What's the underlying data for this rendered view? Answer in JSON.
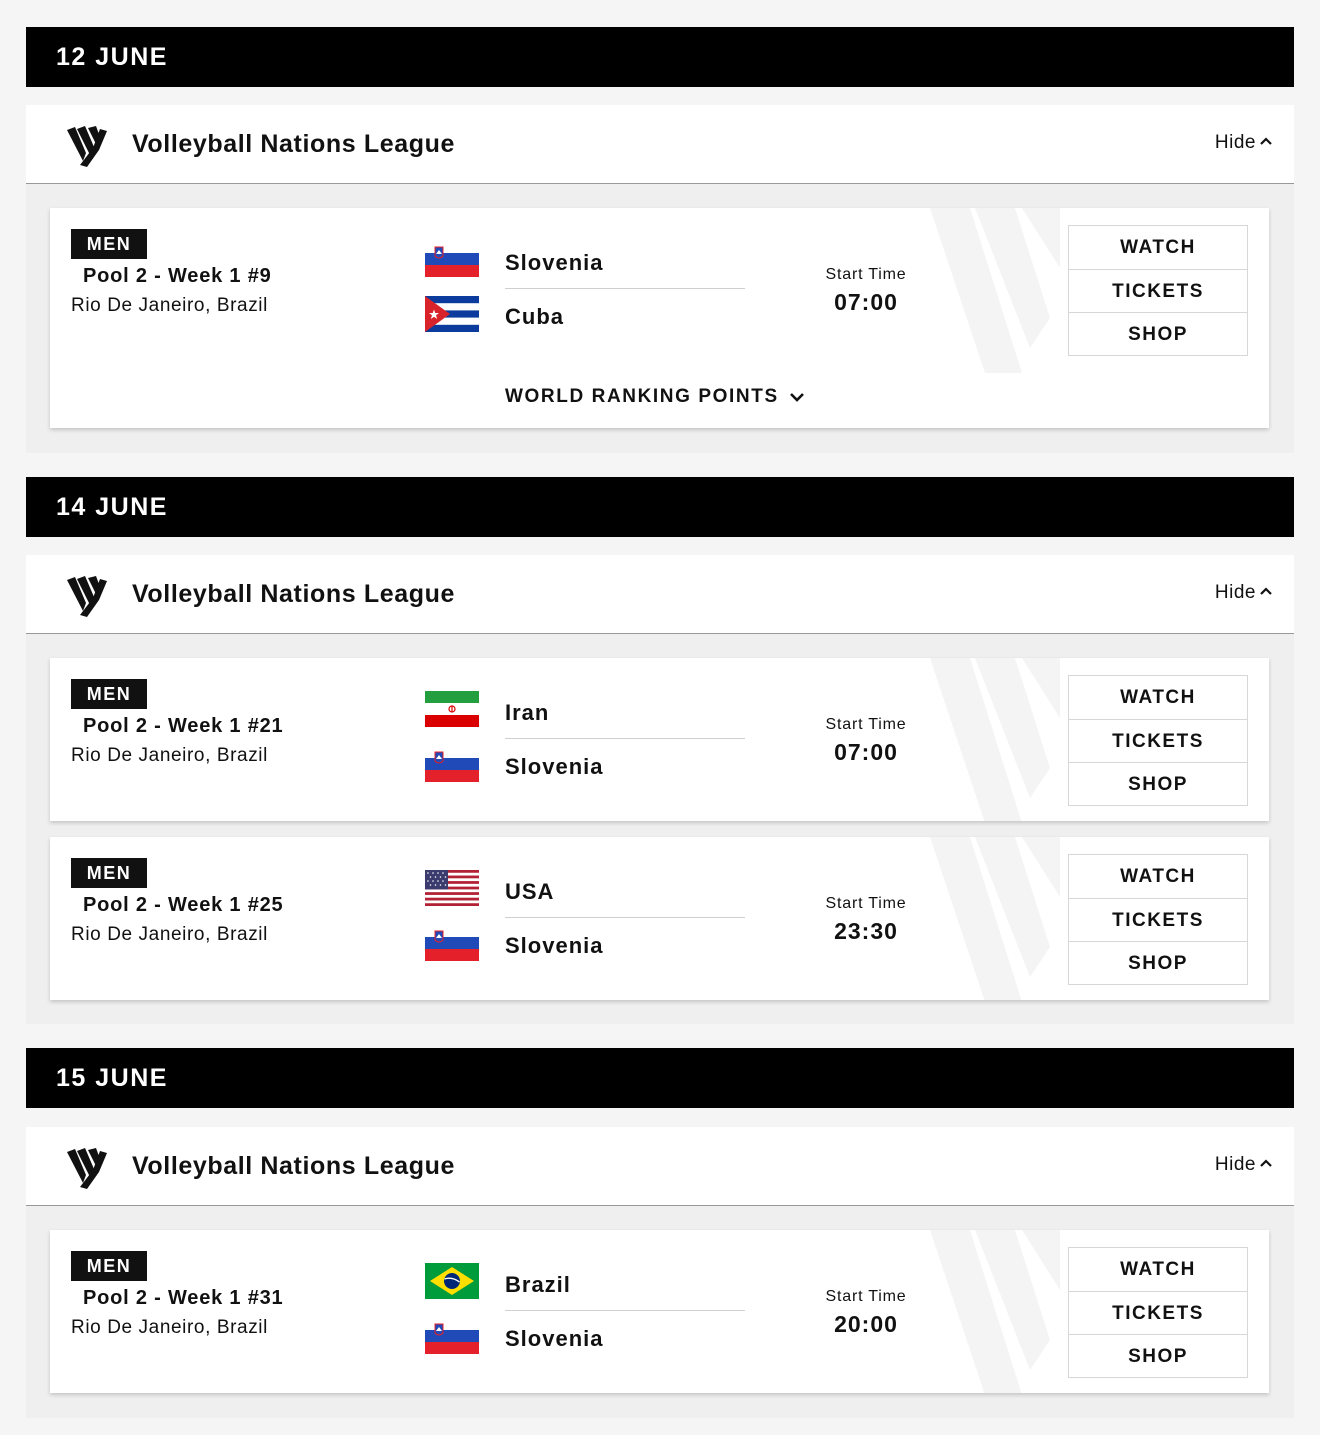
{
  "days": [
    {
      "date": "12 JUNE",
      "competition": "Volleyball Nations League",
      "hide_label": "Hide",
      "matches": [
        {
          "gender": "MEN",
          "pool": "Pool 2 - Week 1 #9",
          "venue": "Rio De Janeiro, Brazil",
          "home": {
            "name": "Slovenia",
            "flag": "slovenia-flag-icon"
          },
          "away": {
            "name": "Cuba",
            "flag": "cuba-flag-icon"
          },
          "start_label": "Start Time",
          "start_time": "07:00",
          "actions": {
            "watch": "WATCH",
            "tickets": "TICKETS",
            "shop": "SHOP"
          },
          "world_ranking_label": "WORLD RANKING POINTS"
        }
      ]
    },
    {
      "date": "14 JUNE",
      "competition": "Volleyball Nations League",
      "hide_label": "Hide",
      "matches": [
        {
          "gender": "MEN",
          "pool": "Pool 2 - Week 1 #21",
          "venue": "Rio De Janeiro, Brazil",
          "home": {
            "name": "Iran",
            "flag": "iran-flag-icon"
          },
          "away": {
            "name": "Slovenia",
            "flag": "slovenia-flag-icon"
          },
          "start_label": "Start Time",
          "start_time": "07:00",
          "actions": {
            "watch": "WATCH",
            "tickets": "TICKETS",
            "shop": "SHOP"
          }
        },
        {
          "gender": "MEN",
          "pool": "Pool 2 - Week 1 #25",
          "venue": "Rio De Janeiro, Brazil",
          "home": {
            "name": "USA",
            "flag": "usa-flag-icon"
          },
          "away": {
            "name": "Slovenia",
            "flag": "slovenia-flag-icon"
          },
          "start_label": "Start Time",
          "start_time": "23:30",
          "actions": {
            "watch": "WATCH",
            "tickets": "TICKETS",
            "shop": "SHOP"
          }
        }
      ]
    },
    {
      "date": "15 JUNE",
      "competition": "Volleyball Nations League",
      "hide_label": "Hide",
      "matches": [
        {
          "gender": "MEN",
          "pool": "Pool 2 - Week 1 #31",
          "venue": "Rio De Janeiro, Brazil",
          "home": {
            "name": "Brazil",
            "flag": "brazil-flag-icon"
          },
          "away": {
            "name": "Slovenia",
            "flag": "slovenia-flag-icon"
          },
          "start_label": "Start Time",
          "start_time": "20:00",
          "actions": {
            "watch": "WATCH",
            "tickets": "TICKETS",
            "shop": "SHOP"
          }
        }
      ]
    }
  ]
}
